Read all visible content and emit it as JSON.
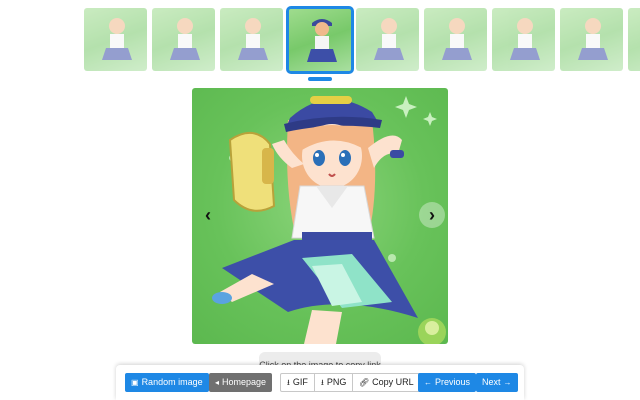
{
  "thumbnails": {
    "count": 9,
    "active_index": 3
  },
  "viewer": {
    "prev_icon": "chevron-left-icon",
    "next_icon": "chevron-right-icon",
    "hint": "Click on the image to copy link"
  },
  "toolbar": {
    "random_label": "Random image",
    "homepage_label": "Homepage",
    "gif_label": "GIF",
    "png_label": "PNG",
    "copy_url_label": "Copy URL",
    "previous_label": "Previous",
    "next_label": "Next"
  },
  "colors": {
    "accent": "#1e88e5",
    "secondary": "#707070",
    "image_bg": "#68c25a"
  }
}
